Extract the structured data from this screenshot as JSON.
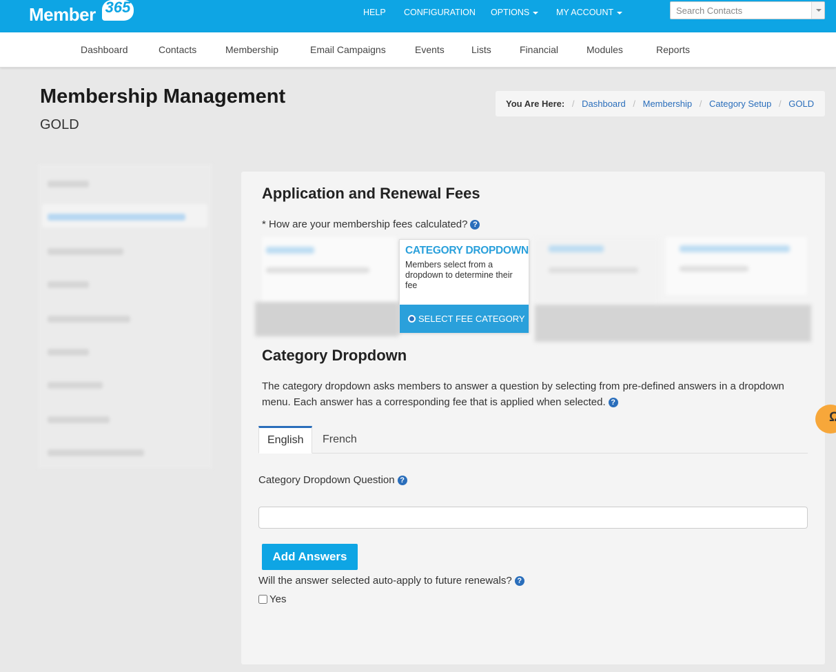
{
  "brand": {
    "name": "Member",
    "number": "365"
  },
  "top_nav": {
    "help": "HELP",
    "configuration": "CONFIGURATION",
    "options": "OPTIONS",
    "my_account": "MY ACCOUNT"
  },
  "search": {
    "placeholder": "Search Contacts"
  },
  "main_nav": [
    "Dashboard",
    "Contacts",
    "Membership",
    "Email Campaigns",
    "Events",
    "Lists",
    "Financial",
    "Modules",
    "Reports"
  ],
  "header": {
    "title": "Membership Management",
    "subtitle": "GOLD"
  },
  "breadcrumb": {
    "label": "You Are Here:",
    "items": [
      "Dashboard",
      "Membership",
      "Category Setup",
      "GOLD"
    ]
  },
  "fees": {
    "heading": "Application and Renewal Fees",
    "question": "* How are your membership fees calculated?",
    "selected_card": {
      "title": "CATEGORY DROPDOWN",
      "description": "Members select from a dropdown to determine their fee",
      "button": "SELECT FEE CATEGORY"
    }
  },
  "category_dropdown": {
    "heading": "Category Dropdown",
    "description": "The category dropdown asks members to answer a question by selecting from pre-defined answers in a dropdown menu. Each answer has a corresponding fee that is applied when selected.",
    "tabs": [
      "English",
      "French"
    ],
    "question_label": "Category Dropdown Question",
    "question_value": "",
    "add_answers_button": "Add Answers",
    "auto_apply_question": "Will the answer selected auto-apply to future renewals?",
    "yes_label": "Yes",
    "yes_checked": false
  },
  "icons": {
    "help": "?",
    "chat": "Ω"
  },
  "colors": {
    "brand_blue": "#0ea5e4",
    "link_blue": "#2a6ebb",
    "card_blue": "#2aa0db",
    "chat_orange": "#f7a73a"
  }
}
